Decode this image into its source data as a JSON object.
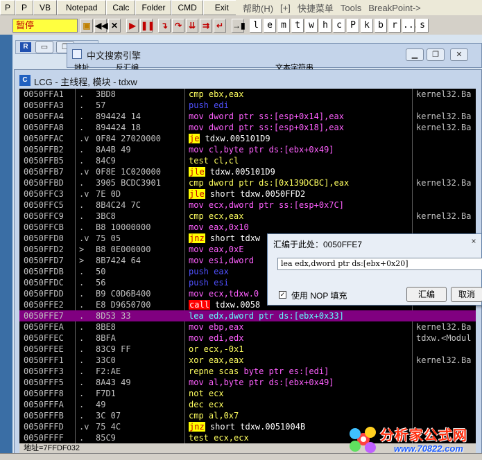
{
  "topbar": {
    "items": [
      "P",
      "P",
      "VB",
      "Notepad",
      "Calc",
      "Folder",
      "CMD",
      "Exit"
    ]
  },
  "menubar": {
    "items": [
      "帮助(H)",
      "[+]",
      "快捷菜单",
      "Tools",
      "BreakPoint->"
    ]
  },
  "toolbar": {
    "status": "暂停",
    "letters": [
      "l",
      "e",
      "m",
      "t",
      "w",
      "h",
      "c",
      "P",
      "k",
      "b",
      "r",
      "...",
      "s"
    ]
  },
  "search_window": {
    "title": "中文搜索引擎",
    "col1": "地址",
    "col2": "反汇编",
    "col3": "文本字符串"
  },
  "main_window": {
    "title": "LCG - 主线程, 模块 - tdxw"
  },
  "disasm": [
    {
      "addr": "0050FFA1",
      "mark": ".",
      "hex": "3BD8",
      "asm": [
        [
          "cmpk",
          "cmp ebx,eax"
        ]
      ],
      "cmt": "kernel32.Ba"
    },
    {
      "addr": "0050FFA3",
      "mark": ".",
      "hex": "57",
      "asm": [
        [
          "push",
          "push edi"
        ]
      ],
      "cmt": ""
    },
    {
      "addr": "0050FFA4",
      "mark": ".",
      "hex": "894424 14",
      "asm": [
        [
          "mv",
          "mov dword ptr ss:[esp+0x14],eax"
        ]
      ],
      "cmt": "kernel32.Ba"
    },
    {
      "addr": "0050FFA8",
      "mark": ".",
      "hex": "894424 18",
      "asm": [
        [
          "mv",
          "mov dword ptr ss:[esp+0x18],eax"
        ]
      ],
      "cmt": "kernel32.Ba"
    },
    {
      "addr": "0050FFAC",
      "mark": ".v",
      "hex": "0F84 27020000",
      "asm": [
        [
          "jmp",
          "je"
        ],
        [
          "plain",
          " tdxw.005101D9"
        ]
      ],
      "cmt": ""
    },
    {
      "addr": "0050FFB2",
      "mark": ".",
      "hex": "8A4B 49",
      "asm": [
        [
          "mv",
          "mov cl,byte ptr ds:[ebx+0x49]"
        ]
      ],
      "cmt": ""
    },
    {
      "addr": "0050FFB5",
      "mark": ".",
      "hex": "84C9",
      "asm": [
        [
          "cmpk",
          "test cl,cl"
        ]
      ],
      "cmt": ""
    },
    {
      "addr": "0050FFB7",
      "mark": ".v",
      "hex": "0F8E 1C020000",
      "asm": [
        [
          "jmp",
          "jle"
        ],
        [
          "plain",
          " tdxw.005101D9"
        ]
      ],
      "cmt": ""
    },
    {
      "addr": "0050FFBD",
      "mark": ".",
      "hex": "3905 BCDC3901",
      "asm": [
        [
          "cmpk",
          "cmp dword ptr ds:[0x139DCBC],eax"
        ]
      ],
      "cmt": "kernel32.Ba"
    },
    {
      "addr": "0050FFC3",
      "mark": ".v",
      "hex": "7E 0D",
      "asm": [
        [
          "jmp",
          "jle"
        ],
        [
          "plain",
          " short tdxw.0050FFD2"
        ]
      ],
      "cmt": ""
    },
    {
      "addr": "0050FFC5",
      "mark": ".",
      "hex": "8B4C24 7C",
      "asm": [
        [
          "mv",
          "mov ecx,dword ptr ss:[esp+0x7C]"
        ]
      ],
      "cmt": ""
    },
    {
      "addr": "0050FFC9",
      "mark": ".",
      "hex": "3BC8",
      "asm": [
        [
          "cmpk",
          "cmp ecx,eax"
        ]
      ],
      "cmt": "kernel32.Ba"
    },
    {
      "addr": "0050FFCB",
      "mark": ".",
      "hex": "B8 10000000",
      "asm": [
        [
          "mv",
          "mov eax,0x10"
        ]
      ],
      "cmt": ""
    },
    {
      "addr": "0050FFD0",
      "mark": ".v",
      "hex": "75 05",
      "asm": [
        [
          "jmp",
          "jnz"
        ],
        [
          "plain",
          " short tdxw"
        ]
      ],
      "cmt": ""
    },
    {
      "addr": "0050FFD2",
      "mark": ">",
      "hex": "B8 0E000000",
      "asm": [
        [
          "mv",
          "mov eax,0xE"
        ]
      ],
      "cmt": ""
    },
    {
      "addr": "0050FFD7",
      "mark": ">",
      "hex": "8B7424 64",
      "asm": [
        [
          "mv",
          "mov esi,dword"
        ]
      ],
      "cmt": ""
    },
    {
      "addr": "0050FFDB",
      "mark": ".",
      "hex": "50",
      "asm": [
        [
          "push",
          "push eax"
        ]
      ],
      "cmt": ""
    },
    {
      "addr": "0050FFDC",
      "mark": ".",
      "hex": "56",
      "asm": [
        [
          "push",
          "push esi"
        ]
      ],
      "cmt": ""
    },
    {
      "addr": "0050FFDD",
      "mark": ".",
      "hex": "B9 C0D6B400",
      "asm": [
        [
          "mv",
          "mov ecx,tdxw.0"
        ]
      ],
      "cmt": ""
    },
    {
      "addr": "0050FFE2",
      "mark": ".",
      "hex": "E8 D9650700",
      "asm": [
        [
          "callk",
          "call"
        ],
        [
          "plain",
          " tdxw.0058"
        ]
      ],
      "cmt": ""
    },
    {
      "addr": "0050FFE7",
      "mark": ".",
      "hex": "8D53 33",
      "asm": [
        [
          "hlop",
          "lea edx,dword ptr ds:[ebx+0x33]"
        ]
      ],
      "cmt": "",
      "hl": true
    },
    {
      "addr": "0050FFEA",
      "mark": ".",
      "hex": "8BE8",
      "asm": [
        [
          "mv",
          "mov ebp,eax"
        ]
      ],
      "cmt": "kernel32.Ba"
    },
    {
      "addr": "0050FFEC",
      "mark": ".",
      "hex": "8BFA",
      "asm": [
        [
          "mv",
          "mov edi,edx"
        ]
      ],
      "cmt": "tdxw.<Modul"
    },
    {
      "addr": "0050FFEE",
      "mark": ".",
      "hex": "83C9 FF",
      "asm": [
        [
          "cmpk",
          "or ecx,-0x1"
        ]
      ],
      "cmt": ""
    },
    {
      "addr": "0050FFF1",
      "mark": ".",
      "hex": "33C0",
      "asm": [
        [
          "cmpk",
          "xor eax,eax"
        ]
      ],
      "cmt": "kernel32.Ba"
    },
    {
      "addr": "0050FFF3",
      "mark": ".",
      "hex": "F2:AE",
      "asm": [
        [
          "cmpk",
          "repne scas"
        ],
        [
          "mv",
          " byte ptr es:[edi]"
        ]
      ],
      "cmt": ""
    },
    {
      "addr": "0050FFF5",
      "mark": ".",
      "hex": "8A43 49",
      "asm": [
        [
          "mv",
          "mov al,byte ptr ds:[ebx+0x49]"
        ]
      ],
      "cmt": ""
    },
    {
      "addr": "0050FFF8",
      "mark": ".",
      "hex": "F7D1",
      "asm": [
        [
          "cmpk",
          "not ecx"
        ]
      ],
      "cmt": ""
    },
    {
      "addr": "0050FFFA",
      "mark": ".",
      "hex": "49",
      "asm": [
        [
          "cmpk",
          "dec ecx"
        ]
      ],
      "cmt": ""
    },
    {
      "addr": "0050FFFB",
      "mark": ".",
      "hex": "3C 07",
      "asm": [
        [
          "cmpk",
          "cmp al,0x7"
        ]
      ],
      "cmt": ""
    },
    {
      "addr": "0050FFFD",
      "mark": ".v",
      "hex": "75 4C",
      "asm": [
        [
          "jmp",
          "jnz"
        ],
        [
          "plain",
          " short tdxw.0051004B"
        ]
      ],
      "cmt": ""
    },
    {
      "addr": "0050FFFF",
      "mark": ".",
      "hex": "85C9",
      "asm": [
        [
          "cmpk",
          "test ecx,ecx"
        ]
      ],
      "cmt": ""
    }
  ],
  "infobar": {
    "text": "地址=7FFDF032"
  },
  "dialog": {
    "title": "汇编于此处：0050FFE7",
    "close": "×",
    "input_value": "lea edx,dword ptr ds:[ebx+0x20]",
    "nop_checked": "✓",
    "nop_label": "使用 NOP 填充",
    "assemble": "汇编",
    "cancel": "取消"
  },
  "watermark": {
    "text": "分析家公式网",
    "url": "www.70822.com"
  },
  "colors": {
    "highlight": "#800080",
    "jump_bg": "#ffff00",
    "call_bg": "#ff0000",
    "status_bg": "#ffff40"
  }
}
